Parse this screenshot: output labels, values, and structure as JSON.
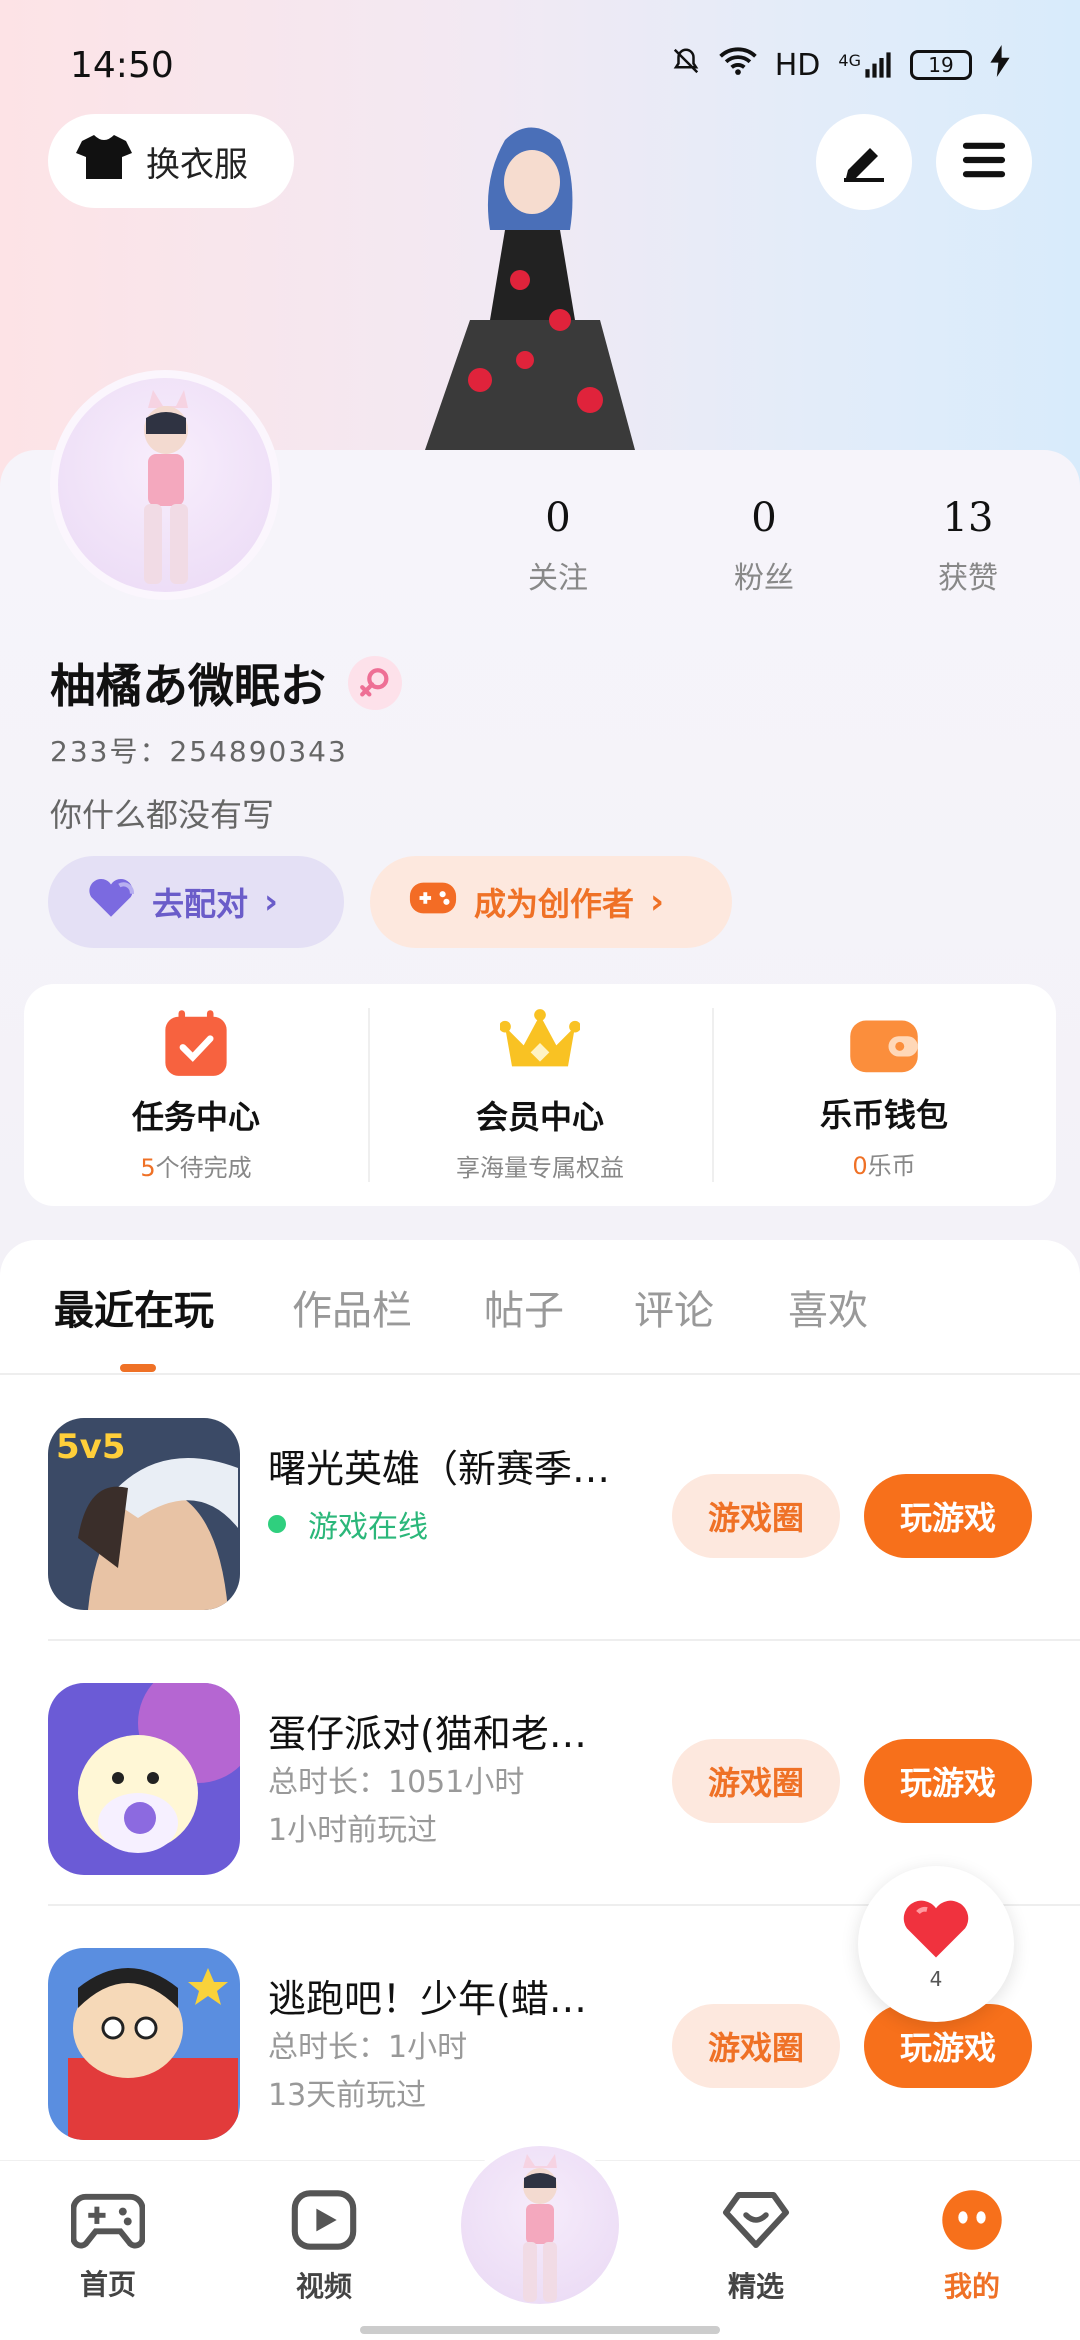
{
  "status_bar": {
    "time": "14:50",
    "network_hd": "HD",
    "network_gen": "4G",
    "battery": "19",
    "icons": [
      "bell-mute-icon",
      "wifi-icon",
      "signal-icon",
      "battery-icon",
      "charging-icon"
    ]
  },
  "header": {
    "outfit_label": "换衣服",
    "edit_icon": "pen-icon",
    "menu_icon": "menu-icon"
  },
  "profile": {
    "stats": [
      {
        "value": "0",
        "label": "关注"
      },
      {
        "value": "0",
        "label": "粉丝"
      },
      {
        "value": "13",
        "label": "获赞"
      }
    ],
    "username": "柚橘あ微眠お",
    "gender": "female",
    "user_id": "233号：254890343",
    "bio": "你什么都没有写"
  },
  "actions": {
    "match_label": "去配对",
    "creator_label": "成为创作者"
  },
  "quick_links": [
    {
      "title": "任务中心",
      "sub_num": "5",
      "sub_text": "个待完成",
      "icon": "calendar-check-icon"
    },
    {
      "title": "会员中心",
      "sub_num": "",
      "sub_text": "享海量专属权益",
      "icon": "crown-icon"
    },
    {
      "title": "乐币钱包",
      "sub_num": "0",
      "sub_text": "乐币",
      "icon": "wallet-icon"
    }
  ],
  "tabs": [
    "最近在玩",
    "作品栏",
    "帖子",
    "评论",
    "喜欢"
  ],
  "games": [
    {
      "name": "曙光英雄（新赛季…",
      "line1": "游戏在线",
      "line2": "",
      "online": true,
      "icon_badge": "5v5"
    },
    {
      "name": "蛋仔派对(猫和老…",
      "line1": "总时长：1051小时",
      "line2": "1小时前玩过",
      "online": false,
      "icon_badge": ""
    },
    {
      "name": "逃跑吧！少年(蜡…",
      "line1": "总时长：1小时",
      "line2": "13天前玩过",
      "online": false,
      "icon_badge": ""
    }
  ],
  "game_buttons": {
    "circle": "游戏圈",
    "play": "玩游戏"
  },
  "like_fab": {
    "count": "4"
  },
  "bottom_nav": [
    {
      "label": "首页",
      "icon": "gamepad-icon"
    },
    {
      "label": "视频",
      "icon": "play-icon"
    },
    {
      "label": "精选",
      "icon": "heart-gem-icon"
    },
    {
      "label": "我的",
      "icon": "face-icon"
    }
  ],
  "colors": {
    "accent": "#F7701B",
    "match": "#6A5CC9",
    "online": "#2BB77A"
  }
}
